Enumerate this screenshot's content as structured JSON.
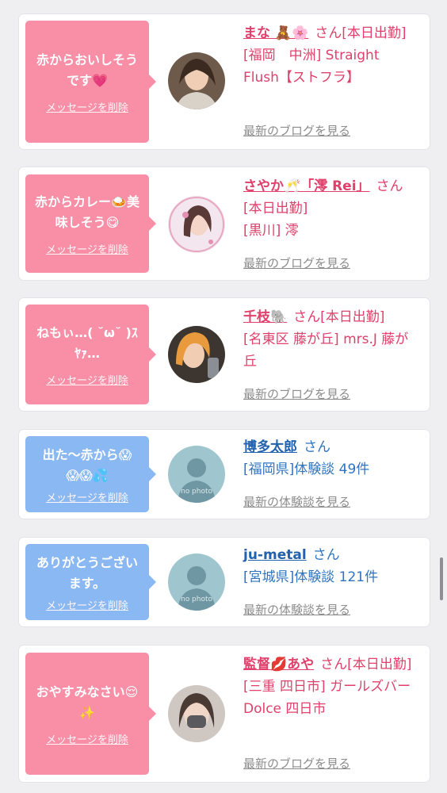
{
  "messages": [
    {
      "message": "赤からおいしそう\nです💗",
      "delete_label": "メッセージを削除",
      "name": "まな 🧸🌸",
      "san": "さん[本日出勤]",
      "shop": "[福岡　中洲] Straight Flush【ストフラ】",
      "link": "最新のブログを見る"
    },
    {
      "message": "赤からカレー🍛美\n味しそう😋",
      "delete_label": "メッセージを削除",
      "name": "さやか🥂「澪 Rei」",
      "san": "さん[本日出勤]",
      "shop": "[黒川] 澪",
      "link": "最新のブログを見る"
    },
    {
      "message": "ねもぃ…( ˘ω˘ )ｽ\nﾔｧ…",
      "delete_label": "メッセージを削除",
      "name": "千枝🐘",
      "san": "さん[本日出勤]",
      "shop": "[名東区 藤が丘] mrs.J 藤が丘",
      "link": "最新のブログを見る"
    },
    {
      "message": "出た〜赤から😱\n😱😱💦",
      "delete_label": "メッセージを削除",
      "name": "博多太郎",
      "san": "さん",
      "shop": "[福岡県]体験談 49件",
      "link": "最新の体験談を見る",
      "avatar_text": "no photo"
    },
    {
      "message": "ありがとうござい\nます。",
      "delete_label": "メッセージを削除",
      "name": "ju-metal",
      "san": "さん",
      "shop": "[宮城県]体験談 121件",
      "link": "最新の体験談を見る",
      "avatar_text": "no photo"
    },
    {
      "message": "おやすみなさい😌\n✨",
      "delete_label": "メッセージを削除",
      "name": "監督💋あや",
      "san": "さん[本日出勤]",
      "shop": "[三重 四日市] ガールズバー Dolce 四日市",
      "link": "最新のブログを見る"
    }
  ],
  "colors": {
    "pink": "#f98fa6",
    "blue": "#8ab8f3",
    "pink_text": "#e0406b",
    "blue_text": "#2161ad"
  }
}
